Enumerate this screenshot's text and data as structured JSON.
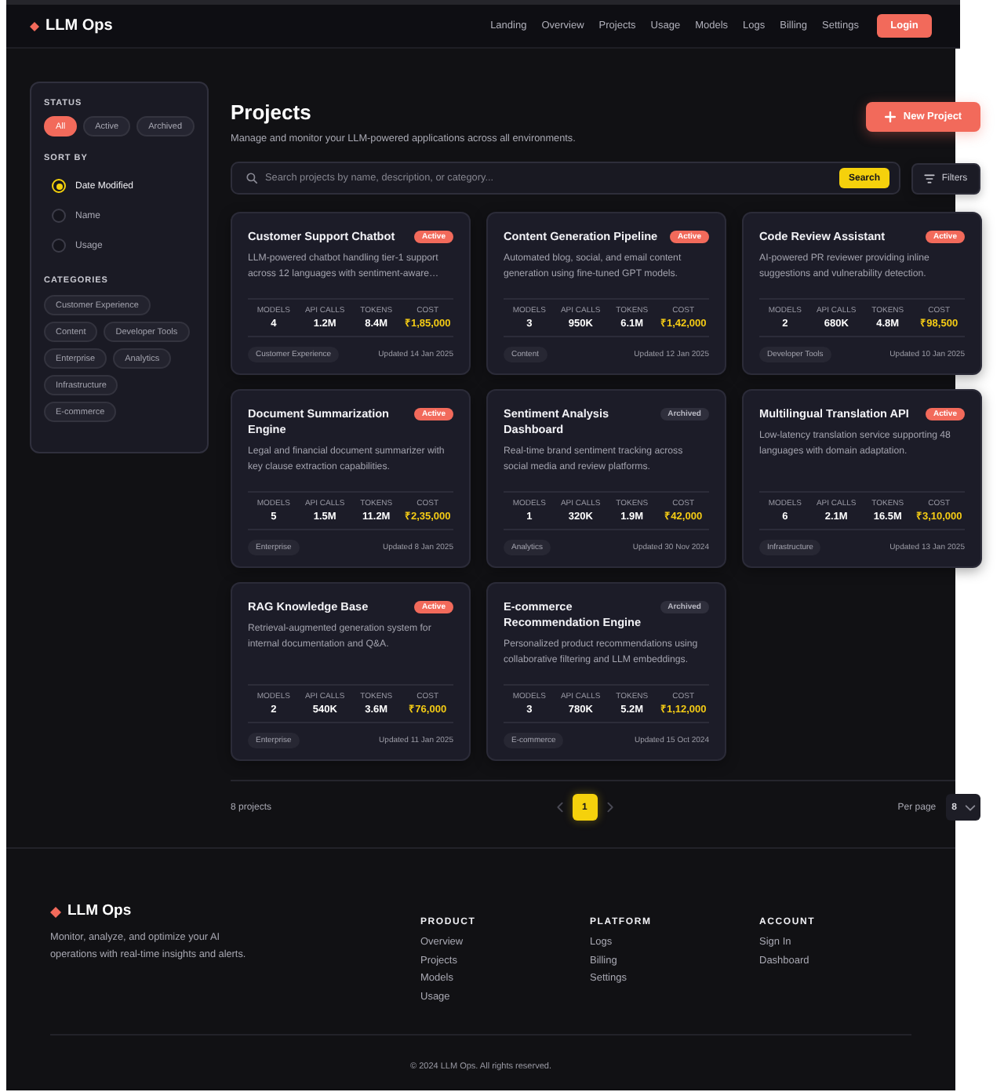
{
  "header": {
    "logo": "LLM Ops",
    "nav": [
      "Landing",
      "Overview",
      "Projects",
      "Usage",
      "Models",
      "Logs",
      "Billing",
      "Settings"
    ],
    "login": "Login"
  },
  "sidebar": {
    "status": {
      "title": "STATUS",
      "options": [
        {
          "label": "All",
          "selected": true
        },
        {
          "label": "Active",
          "selected": false
        },
        {
          "label": "Archived",
          "selected": false
        }
      ]
    },
    "sort": {
      "title": "SORT BY",
      "options": [
        {
          "label": "Date Modified",
          "selected": true
        },
        {
          "label": "Name",
          "selected": false
        },
        {
          "label": "Usage",
          "selected": false
        }
      ]
    },
    "categories": {
      "title": "CATEGORIES",
      "items": [
        "Customer Experience",
        "Content",
        "Developer Tools",
        "Enterprise",
        "Analytics",
        "Infrastructure",
        "E-commerce"
      ]
    }
  },
  "page": {
    "title": "Projects",
    "subtitle": "Manage and monitor your LLM-powered applications across all environments.",
    "new_button": "New Project"
  },
  "search": {
    "placeholder": "Search projects by name, description, or category...",
    "button": "Search",
    "filters": "Filters"
  },
  "projects": [
    {
      "name": "Customer Support Chatbot",
      "status": {
        "label": "Active",
        "archived": false
      },
      "description": "LLM-powered chatbot handling tier-1 support across 12 languages with sentiment-aware…",
      "stats": [
        {
          "label": "MODELS",
          "value": "4",
          "kind": "count"
        },
        {
          "label": "API CALLS",
          "value": "1.2M",
          "kind": "count"
        },
        {
          "label": "TOKENS",
          "value": "8.4M",
          "kind": "count"
        },
        {
          "label": "COST",
          "value": "₹1,85,000",
          "kind": "money"
        }
      ],
      "category": "Customer Experience",
      "updated": "Updated 14 Jan 2025"
    },
    {
      "name": "Content Generation Pipeline",
      "status": {
        "label": "Active",
        "archived": false
      },
      "description": "Automated blog, social, and email content generation using fine-tuned GPT models.",
      "stats": [
        {
          "label": "MODELS",
          "value": "3",
          "kind": "count"
        },
        {
          "label": "API CALLS",
          "value": "950K",
          "kind": "count"
        },
        {
          "label": "TOKENS",
          "value": "6.1M",
          "kind": "count"
        },
        {
          "label": "COST",
          "value": "₹1,42,000",
          "kind": "money"
        }
      ],
      "category": "Content",
      "updated": "Updated 12 Jan 2025"
    },
    {
      "name": "Code Review Assistant",
      "status": {
        "label": "Active",
        "archived": false
      },
      "description": "AI-powered PR reviewer providing inline suggestions and vulnerability detection.",
      "stats": [
        {
          "label": "MODELS",
          "value": "2",
          "kind": "count"
        },
        {
          "label": "API CALLS",
          "value": "680K",
          "kind": "count"
        },
        {
          "label": "TOKENS",
          "value": "4.8M",
          "kind": "count"
        },
        {
          "label": "COST",
          "value": "₹98,500",
          "kind": "money"
        }
      ],
      "category": "Developer Tools",
      "updated": "Updated 10 Jan 2025"
    },
    {
      "name": "Document Summarization Engine",
      "status": {
        "label": "Active",
        "archived": false
      },
      "description": "Legal and financial document summarizer with key clause extraction capabilities.",
      "stats": [
        {
          "label": "MODELS",
          "value": "5",
          "kind": "count"
        },
        {
          "label": "API CALLS",
          "value": "1.5M",
          "kind": "count"
        },
        {
          "label": "TOKENS",
          "value": "11.2M",
          "kind": "count"
        },
        {
          "label": "COST",
          "value": "₹2,35,000",
          "kind": "money"
        }
      ],
      "category": "Enterprise",
      "updated": "Updated 8 Jan 2025"
    },
    {
      "name": "Sentiment Analysis Dashboard",
      "status": {
        "label": "Archived",
        "archived": true
      },
      "description": "Real-time brand sentiment tracking across social media and review platforms.",
      "stats": [
        {
          "label": "MODELS",
          "value": "1",
          "kind": "count"
        },
        {
          "label": "API CALLS",
          "value": "320K",
          "kind": "count"
        },
        {
          "label": "TOKENS",
          "value": "1.9M",
          "kind": "count"
        },
        {
          "label": "COST",
          "value": "₹42,000",
          "kind": "money"
        }
      ],
      "category": "Analytics",
      "updated": "Updated 30 Nov 2024"
    },
    {
      "name": "Multilingual Translation API",
      "status": {
        "label": "Active",
        "archived": false
      },
      "description": "Low-latency translation service supporting 48 languages with domain adaptation.",
      "stats": [
        {
          "label": "MODELS",
          "value": "6",
          "kind": "count"
        },
        {
          "label": "API CALLS",
          "value": "2.1M",
          "kind": "count"
        },
        {
          "label": "TOKENS",
          "value": "16.5M",
          "kind": "count"
        },
        {
          "label": "COST",
          "value": "₹3,10,000",
          "kind": "money"
        }
      ],
      "category": "Infrastructure",
      "updated": "Updated 13 Jan 2025"
    },
    {
      "name": "RAG Knowledge Base",
      "status": {
        "label": "Active",
        "archived": false
      },
      "description": "Retrieval-augmented generation system for internal documentation and Q&A.",
      "stats": [
        {
          "label": "MODELS",
          "value": "2",
          "kind": "count"
        },
        {
          "label": "API CALLS",
          "value": "540K",
          "kind": "count"
        },
        {
          "label": "TOKENS",
          "value": "3.6M",
          "kind": "count"
        },
        {
          "label": "COST",
          "value": "₹76,000",
          "kind": "money"
        }
      ],
      "category": "Enterprise",
      "updated": "Updated 11 Jan 2025"
    },
    {
      "name": "E-commerce Recommendation Engine",
      "status": {
        "label": "Archived",
        "archived": true
      },
      "description": "Personalized product recommendations using collaborative filtering and LLM embeddings.",
      "stats": [
        {
          "label": "MODELS",
          "value": "3",
          "kind": "count"
        },
        {
          "label": "API CALLS",
          "value": "780K",
          "kind": "count"
        },
        {
          "label": "TOKENS",
          "value": "5.2M",
          "kind": "count"
        },
        {
          "label": "COST",
          "value": "₹1,12,000",
          "kind": "money"
        }
      ],
      "category": "E-commerce",
      "updated": "Updated 15 Oct 2024"
    }
  ],
  "pagination": {
    "count": "8 projects",
    "pages": [
      {
        "label": "1",
        "selected": true
      }
    ],
    "per_page_label": "Per page",
    "per_page": "8"
  },
  "footer": {
    "logo": "LLM Ops",
    "tagline": "Monitor, analyze, and optimize your AI operations with real-time insights and alerts.",
    "columns": [
      {
        "title": "PRODUCT",
        "links": [
          "Overview",
          "Projects",
          "Models",
          "Usage"
        ]
      },
      {
        "title": "PLATFORM",
        "links": [
          "Logs",
          "Billing",
          "Settings"
        ]
      },
      {
        "title": "ACCOUNT",
        "links": [
          "Sign In",
          "Dashboard"
        ]
      }
    ],
    "copyright": "© 2024 LLM Ops. All rights reserved."
  }
}
